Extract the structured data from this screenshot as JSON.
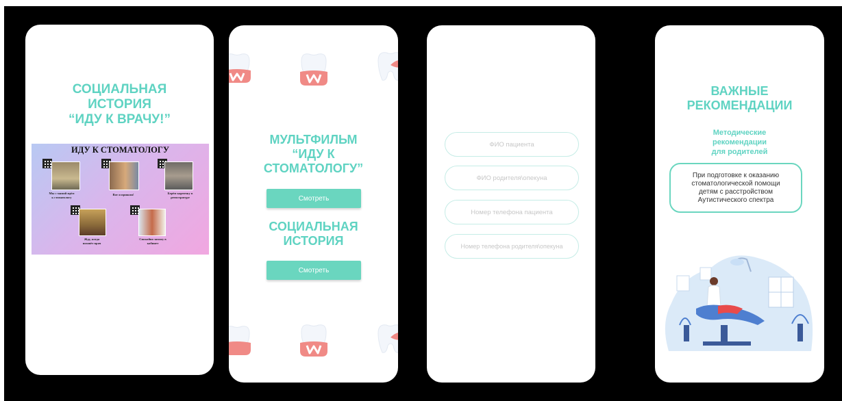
{
  "screen1": {
    "title_lines": [
      "СОЦИАЛЬНАЯ",
      "ИСТОРИЯ",
      "“ИДУ К ВРАЧУ!”"
    ],
    "poster": {
      "title": "ИДУ К СТОМАТОЛОГУ",
      "captions": [
        [
          "Мы с мамой идём",
          "к стоматологу"
        ],
        [
          "Вот и пришли!"
        ],
        [
          "Берём карточку в",
          "регистратуре"
        ],
        [
          "Жду, когда",
          "позовёт врач"
        ],
        [
          "Спокойно захожу в",
          "кабинет"
        ]
      ]
    }
  },
  "screen2": {
    "title_a_lines": [
      "МУЛЬТФИЛЬМ",
      "“ИДУ К",
      "СТОМАТОЛОГУ”"
    ],
    "button1": "Смотреть",
    "title_b_lines": [
      "СОЦИАЛЬНАЯ",
      "ИСТОРИЯ"
    ],
    "button2": "Смотреть"
  },
  "screen3": {
    "fields": [
      {
        "placeholder": "ФИО пациента"
      },
      {
        "placeholder": "ФИО родителя\\опекуна"
      },
      {
        "placeholder": "Номер телефона пациента"
      },
      {
        "placeholder": "Номер телефона родителя\\опекуна"
      }
    ]
  },
  "screen4": {
    "title_lines": [
      "ВАЖНЫЕ",
      "РЕКОМЕНДАЦИИ"
    ],
    "subtitle_lines": [
      "Методические",
      "рекомендации",
      "для родителей"
    ],
    "info_lines": [
      "При подготовке к оказанию",
      "стоматологической помощи",
      "детям с расстройством",
      "Аутистического спектра"
    ]
  },
  "colors": {
    "accent": "#5fd3c2",
    "button": "#6ad6bf",
    "background": "#000000",
    "field_border": "#c5ece6",
    "gum": "#f08a86"
  },
  "icons": [
    "tooth-icon",
    "qr-code-icon",
    "dentist-illustration"
  ]
}
